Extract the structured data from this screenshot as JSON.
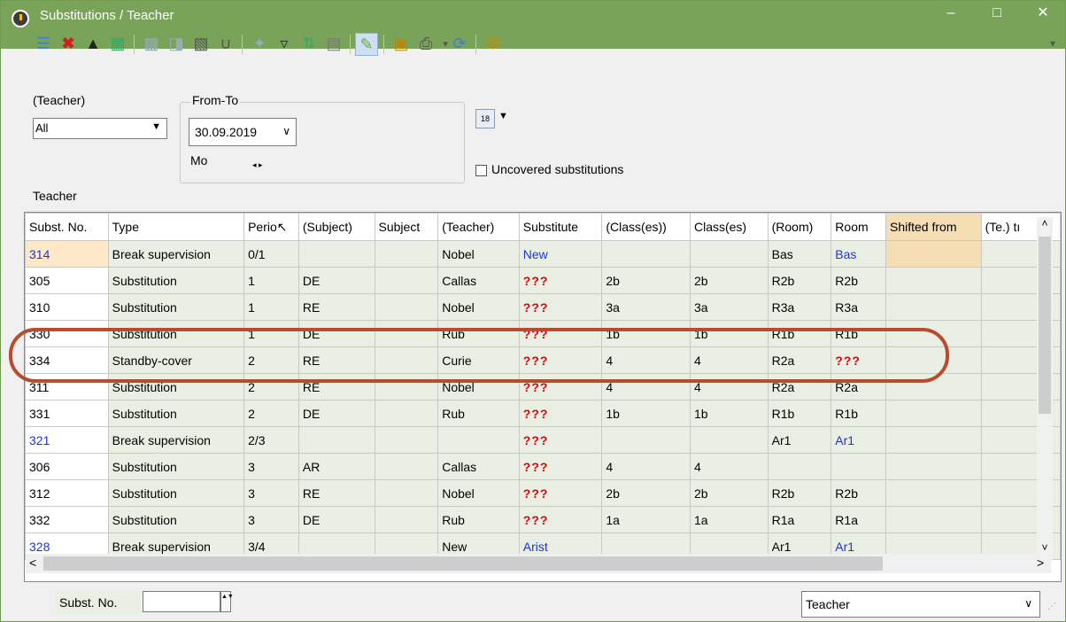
{
  "window": {
    "title": "Substitutions / Teacher",
    "controls": {
      "minimize": "–",
      "maximize": "□",
      "close": "✕"
    }
  },
  "toolbar": {
    "icons": [
      "list-icon",
      "delete-icon",
      "graduation-cap-icon",
      "export-icon",
      "copy-icon",
      "import-icon",
      "calculator-icon",
      "stethoscope-icon",
      "wand-icon",
      "filter-icon",
      "sort-icon",
      "columns-icon",
      "edit-note-icon",
      "lock-icon",
      "print-icon",
      "refresh-icon",
      "settings-gear-icon"
    ],
    "overflow": "▾"
  },
  "filter": {
    "teacher_label": "(Teacher)",
    "teacher_value": "All",
    "from_to_label": "From-To",
    "date_value": "30.09.2019",
    "weekday": "Mo",
    "stepper": "◂ ▸",
    "uncovered_label": "Uncovered substitutions",
    "section_label": "Teacher"
  },
  "table": {
    "columns": [
      "Subst. No.",
      "Type",
      "Perio↖",
      "(Subject)",
      "Subject",
      "(Teacher)",
      "Substitute",
      "(Class(es))",
      "Class(es)",
      "(Room)",
      "Room",
      "Shifted from",
      "(Te.) tı"
    ],
    "rows": [
      {
        "no": "314",
        "type": "Break supervision",
        "period": "0/1",
        "subj_old": "",
        "subj": "",
        "teacher": "Nobel",
        "subst": "New",
        "class_old": "",
        "class": "",
        "room_old": "Bas",
        "room": "Bas",
        "shifted": "",
        "te": "",
        "no_style": "blue",
        "subst_style": "blue",
        "room_style": "blue",
        "highlight": "orange"
      },
      {
        "no": "305",
        "type": "Substitution",
        "period": "1",
        "subj_old": "DE",
        "subj": "",
        "teacher": "Callas",
        "subst": "???",
        "class_old": "2b",
        "class": "2b",
        "room_old": "R2b",
        "room": "R2b",
        "shifted": "",
        "te": "",
        "no_style": "",
        "subst_style": "red",
        "room_style": ""
      },
      {
        "no": "310",
        "type": "Substitution",
        "period": "1",
        "subj_old": "RE",
        "subj": "",
        "teacher": "Nobel",
        "subst": "???",
        "class_old": "3a",
        "class": "3a",
        "room_old": "R3a",
        "room": "R3a",
        "shifted": "",
        "te": "",
        "no_style": "",
        "subst_style": "red",
        "room_style": ""
      },
      {
        "no": "330",
        "type": "Substitution",
        "period": "1",
        "subj_old": "DE",
        "subj": "",
        "teacher": "Rub",
        "subst": "???",
        "class_old": "1b",
        "class": "1b",
        "room_old": "R1b",
        "room": "R1b",
        "shifted": "",
        "te": "",
        "no_style": "",
        "subst_style": "red",
        "room_style": ""
      },
      {
        "no": "334",
        "type": "Standby-cover",
        "period": "2",
        "subj_old": "RE",
        "subj": "",
        "teacher": "Curie",
        "subst": "???",
        "class_old": "4",
        "class": "4",
        "room_old": "R2a",
        "room": "???",
        "shifted": "",
        "te": "",
        "no_style": "",
        "subst_style": "red",
        "room_style": "red"
      },
      {
        "no": "311",
        "type": "Substitution",
        "period": "2",
        "subj_old": "RE",
        "subj": "",
        "teacher": "Nobel",
        "subst": "???",
        "class_old": "4",
        "class": "4",
        "room_old": "R2a",
        "room": "R2a",
        "shifted": "",
        "te": "",
        "no_style": "",
        "subst_style": "red",
        "room_style": ""
      },
      {
        "no": "331",
        "type": "Substitution",
        "period": "2",
        "subj_old": "DE",
        "subj": "",
        "teacher": "Rub",
        "subst": "???",
        "class_old": "1b",
        "class": "1b",
        "room_old": "R1b",
        "room": "R1b",
        "shifted": "",
        "te": "",
        "no_style": "",
        "subst_style": "red",
        "room_style": ""
      },
      {
        "no": "321",
        "type": "Break supervision",
        "period": "2/3",
        "subj_old": "",
        "subj": "",
        "teacher": "",
        "subst": "???",
        "class_old": "",
        "class": "",
        "room_old": "Ar1",
        "room": "Ar1",
        "shifted": "",
        "te": "",
        "no_style": "blue",
        "subst_style": "red",
        "room_style": "blue"
      },
      {
        "no": "306",
        "type": "Substitution",
        "period": "3",
        "subj_old": "AR",
        "subj": "",
        "teacher": "Callas",
        "subst": "???",
        "class_old": "4",
        "class": "4",
        "room_old": "",
        "room": "",
        "shifted": "",
        "te": "",
        "no_style": "",
        "subst_style": "red",
        "room_style": ""
      },
      {
        "no": "312",
        "type": "Substitution",
        "period": "3",
        "subj_old": "RE",
        "subj": "",
        "teacher": "Nobel",
        "subst": "???",
        "class_old": "2b",
        "class": "2b",
        "room_old": "R2b",
        "room": "R2b",
        "shifted": "",
        "te": "",
        "no_style": "",
        "subst_style": "red",
        "room_style": ""
      },
      {
        "no": "332",
        "type": "Substitution",
        "period": "3",
        "subj_old": "DE",
        "subj": "",
        "teacher": "Rub",
        "subst": "???",
        "class_old": "1a",
        "class": "1a",
        "room_old": "R1a",
        "room": "R1a",
        "shifted": "",
        "te": "",
        "no_style": "",
        "subst_style": "red",
        "room_style": ""
      },
      {
        "no": "328",
        "type": "Break supervision",
        "period": "3/4",
        "subj_old": "",
        "subj": "",
        "teacher": "New",
        "subst": "Arist",
        "class_old": "",
        "class": "",
        "room_old": "Ar1",
        "room": "Ar1",
        "shifted": "",
        "te": "",
        "no_style": "blue",
        "subst_style": "blue",
        "room_style": "blue"
      }
    ]
  },
  "scroll": {
    "up": "˄",
    "down": "˅",
    "left": "<",
    "right": ">"
  },
  "bottom": {
    "subst_no_label": "Subst. No.",
    "subst_no_value": "",
    "spin": "▲▼",
    "view_select": "Teacher",
    "view_arrow": "∨"
  },
  "colors": {
    "titlebar": "#7aa35a",
    "row_bg": "#e9f0e3",
    "highlight_orange": "#fde9c9",
    "shifted_header": "#f5ddb4",
    "red": "#e00000",
    "blue": "#1c35d8",
    "annotation": "#b84c2f"
  }
}
